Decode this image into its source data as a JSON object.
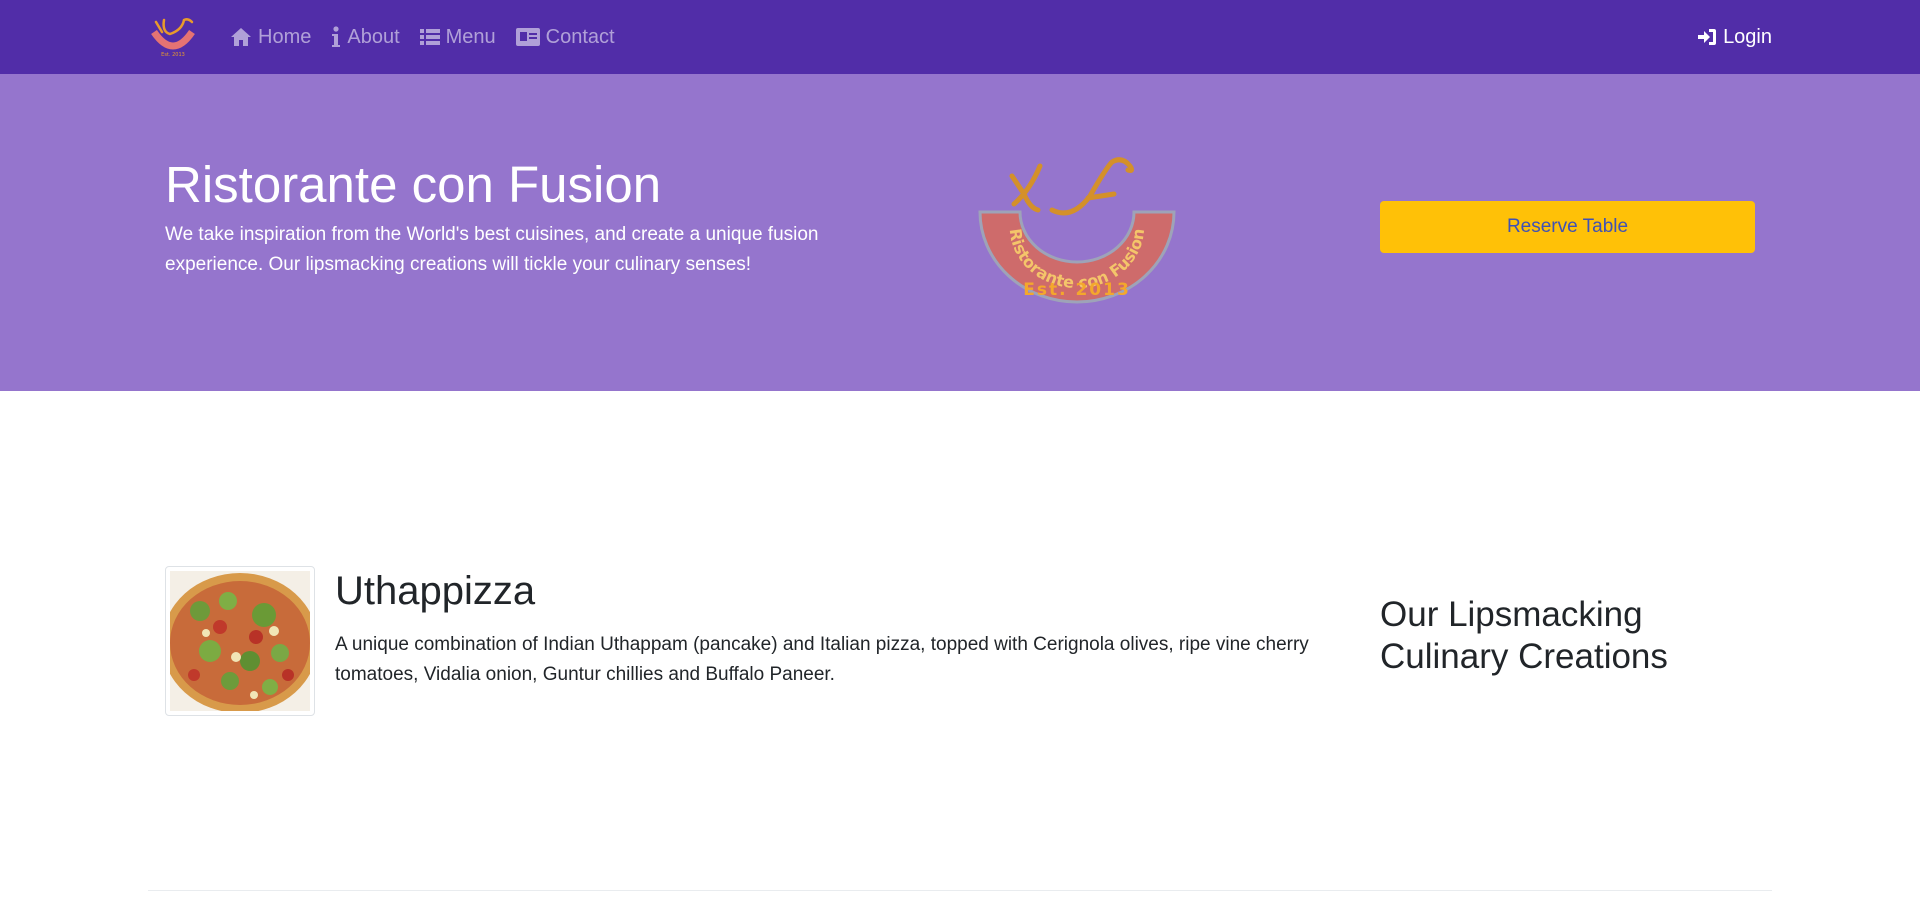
{
  "navbar": {
    "brand_icon": "restaurant-logo",
    "links": [
      {
        "label": "Home",
        "icon": "home-icon"
      },
      {
        "label": "About",
        "icon": "info-icon"
      },
      {
        "label": "Menu",
        "icon": "list-icon"
      },
      {
        "label": "Contact",
        "icon": "address-card-icon"
      }
    ],
    "login": {
      "label": "Login",
      "icon": "sign-in-icon"
    }
  },
  "jumbotron": {
    "title": "Ristorante con Fusion",
    "text": "We take inspiration from the World's best cuisines, and create a unique fusion experience. Our lipsmacking creations will tickle your culinary senses!",
    "logo_text": "Ristorante con Fusion",
    "logo_est": "Est. 2013",
    "reserve_label": "Reserve Table"
  },
  "featured": {
    "name": "Uthappizza",
    "description": "A unique combination of Indian Uthappam (pancake) and Italian pizza, topped with Cerignola olives, ripe vine cherry tomatoes, Vidalia onion, Guntur chillies and Buffalo Paneer."
  },
  "side": {
    "heading": "Our Lipsmacking Culinary Creations"
  },
  "colors": {
    "navbar": "#512da8",
    "jumbotron": "#9575cd",
    "accent_button": "#ffc107",
    "button_text": "#3f51b5"
  }
}
